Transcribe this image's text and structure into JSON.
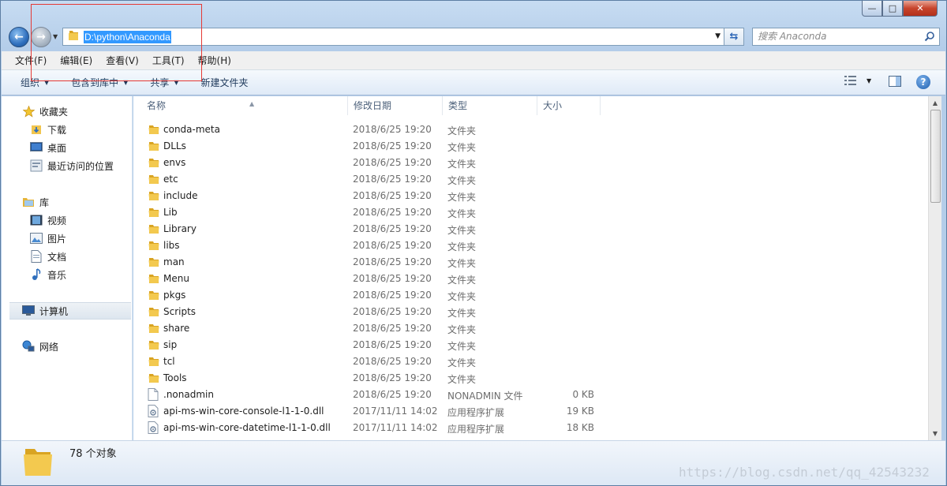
{
  "address": {
    "path": "D:\\python\\Anaconda"
  },
  "search": {
    "placeholder": "搜索 Anaconda"
  },
  "menu": [
    "文件(F)",
    "编辑(E)",
    "查看(V)",
    "工具(T)",
    "帮助(H)"
  ],
  "toolbar": {
    "organize": "组织",
    "include_library": "包含到库中",
    "share": "共享",
    "new_folder": "新建文件夹"
  },
  "sidebar": {
    "favorites": {
      "label": "收藏夹",
      "items": [
        "下载",
        "桌面",
        "最近访问的位置"
      ]
    },
    "libraries": {
      "label": "库",
      "items": [
        "视频",
        "图片",
        "文档",
        "音乐"
      ]
    },
    "computer": "计算机",
    "network": "网络"
  },
  "columns": {
    "name": "名称",
    "date": "修改日期",
    "type": "类型",
    "size": "大小"
  },
  "files": [
    {
      "name": "conda-meta",
      "date": "2018/6/25 19:20",
      "type": "文件夹",
      "size": "",
      "kind": "folder"
    },
    {
      "name": "DLLs",
      "date": "2018/6/25 19:20",
      "type": "文件夹",
      "size": "",
      "kind": "folder"
    },
    {
      "name": "envs",
      "date": "2018/6/25 19:20",
      "type": "文件夹",
      "size": "",
      "kind": "folder"
    },
    {
      "name": "etc",
      "date": "2018/6/25 19:20",
      "type": "文件夹",
      "size": "",
      "kind": "folder"
    },
    {
      "name": "include",
      "date": "2018/6/25 19:20",
      "type": "文件夹",
      "size": "",
      "kind": "folder"
    },
    {
      "name": "Lib",
      "date": "2018/6/25 19:20",
      "type": "文件夹",
      "size": "",
      "kind": "folder"
    },
    {
      "name": "Library",
      "date": "2018/6/25 19:20",
      "type": "文件夹",
      "size": "",
      "kind": "folder"
    },
    {
      "name": "libs",
      "date": "2018/6/25 19:20",
      "type": "文件夹",
      "size": "",
      "kind": "folder"
    },
    {
      "name": "man",
      "date": "2018/6/25 19:20",
      "type": "文件夹",
      "size": "",
      "kind": "folder"
    },
    {
      "name": "Menu",
      "date": "2018/6/25 19:20",
      "type": "文件夹",
      "size": "",
      "kind": "folder"
    },
    {
      "name": "pkgs",
      "date": "2018/6/25 19:20",
      "type": "文件夹",
      "size": "",
      "kind": "folder"
    },
    {
      "name": "Scripts",
      "date": "2018/6/25 19:20",
      "type": "文件夹",
      "size": "",
      "kind": "folder"
    },
    {
      "name": "share",
      "date": "2018/6/25 19:20",
      "type": "文件夹",
      "size": "",
      "kind": "folder"
    },
    {
      "name": "sip",
      "date": "2018/6/25 19:20",
      "type": "文件夹",
      "size": "",
      "kind": "folder"
    },
    {
      "name": "tcl",
      "date": "2018/6/25 19:20",
      "type": "文件夹",
      "size": "",
      "kind": "folder"
    },
    {
      "name": "Tools",
      "date": "2018/6/25 19:20",
      "type": "文件夹",
      "size": "",
      "kind": "folder"
    },
    {
      "name": ".nonadmin",
      "date": "2018/6/25 19:20",
      "type": "NONADMIN 文件",
      "size": "0 KB",
      "kind": "file"
    },
    {
      "name": "api-ms-win-core-console-l1-1-0.dll",
      "date": "2017/11/11 14:02",
      "type": "应用程序扩展",
      "size": "19 KB",
      "kind": "dll"
    },
    {
      "name": "api-ms-win-core-datetime-l1-1-0.dll",
      "date": "2017/11/11 14:02",
      "type": "应用程序扩展",
      "size": "18 KB",
      "kind": "dll"
    }
  ],
  "status": {
    "count": "78 个对象"
  },
  "watermark": "https://blog.csdn.net/qq_42543232",
  "colors": {
    "folder": "#e8b83a",
    "selection": "#3399ff",
    "annotation": "#e53935"
  }
}
